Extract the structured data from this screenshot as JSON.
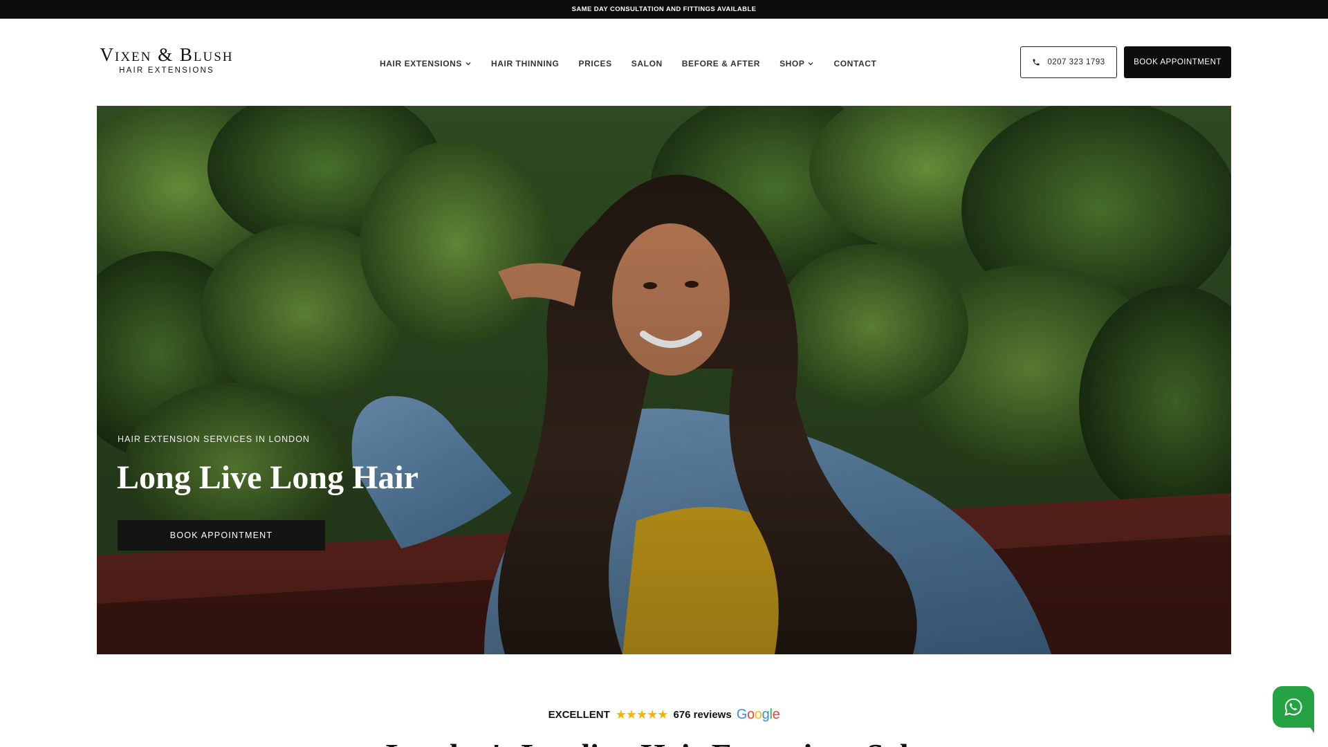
{
  "topbar": {
    "text": "SAME DAY CONSULTATION AND FITTINGS AVAILABLE"
  },
  "logo": {
    "main": "Vixen & Blush",
    "sub": "HAIR EXTENSIONS"
  },
  "nav": {
    "items": [
      {
        "label": "HAIR EXTENSIONS",
        "dropdown": true
      },
      {
        "label": "HAIR THINNING",
        "dropdown": false
      },
      {
        "label": "PRICES",
        "dropdown": false
      },
      {
        "label": "SALON",
        "dropdown": false
      },
      {
        "label": "BEFORE & AFTER",
        "dropdown": false
      },
      {
        "label": "SHOP",
        "dropdown": true
      },
      {
        "label": "CONTACT",
        "dropdown": false
      }
    ]
  },
  "header_actions": {
    "phone": "0207 323 1793",
    "phone_icon": "phone-icon",
    "book": "BOOK APPOINTMENT"
  },
  "hero": {
    "kicker": "HAIR EXTENSION SERVICES IN LONDON",
    "title": "Long Live Long Hair",
    "button": "BOOK APPOINTMENT"
  },
  "reviews": {
    "rating_word": "EXCELLENT",
    "stars": 5,
    "count": "676 reviews",
    "provider": "Google"
  },
  "section": {
    "heading": "London's Leading Hair Extensions Salon"
  },
  "colors": {
    "topbar_bg": "#0d0d0d",
    "button_bg": "#0d0d0d",
    "whatsapp": "#25a244",
    "stars": "#f4b400"
  },
  "floating": {
    "icon": "whatsapp-icon"
  }
}
